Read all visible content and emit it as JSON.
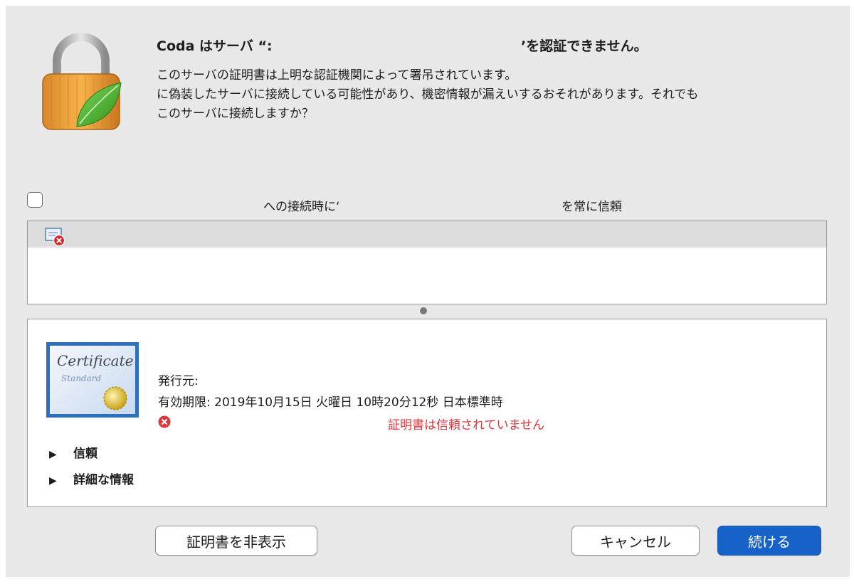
{
  "dialog": {
    "title_start": "Coda はサーバ “:",
    "title_end": "’を認証できません。",
    "message_lines": [
      "このサーバの証明書は上明な認証機関によって署吊されています。",
      "に偽装したサーバに接続している可能性があり、機密情報が漏えいするおそれがあります。それでも",
      "このサーバに接続しますか？"
    ]
  },
  "trust": {
    "label_start": "への接続時に‘",
    "label_end": "を常に信頼"
  },
  "certificate": {
    "image_text_1": "Certificate",
    "image_text_2": "Standard",
    "issuer_label": "発行元:",
    "expiry": "有効期限: 2019年10月15日 火曜日 10時20分12秒 日本標準時",
    "error_text": "証明書は信頼されていません",
    "sections": [
      "信頼",
      "詳細な情報"
    ]
  },
  "buttons": {
    "hide": "証明書を非表示",
    "cancel": "キャンセル",
    "continue": "続ける"
  },
  "icons": {
    "lock": "lock-leaf-icon",
    "chain": "certificate-error-icon",
    "error": "error-x-icon"
  },
  "colors": {
    "primary_button": "#1762c9",
    "error": "#e0373a"
  }
}
